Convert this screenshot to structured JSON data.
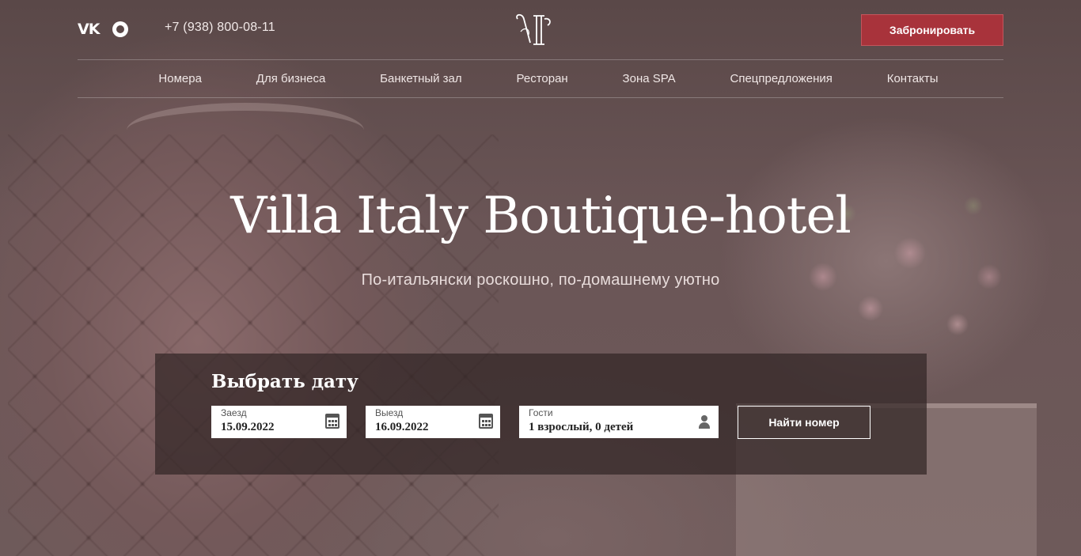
{
  "header": {
    "social": {
      "vk_icon": "vk-icon",
      "whatsapp_icon": "whatsapp-icon",
      "vk_glyph": "VK"
    },
    "phone": "+7 (938) 800-08-11",
    "book_button": "Забронировать",
    "brand_color": "#a8333b"
  },
  "nav": {
    "items": [
      {
        "label": "Номера"
      },
      {
        "label": "Для бизнеса"
      },
      {
        "label": "Банкетный зал"
      },
      {
        "label": "Ресторан"
      },
      {
        "label": "Зона SPA"
      },
      {
        "label": "Спецпредложения"
      },
      {
        "label": "Контакты"
      }
    ]
  },
  "hero": {
    "title": "Villa Italy Boutique-hotel",
    "subtitle": "По-итальянски роскошно, по-домашнему уютно"
  },
  "booking": {
    "title": "Выбрать дату",
    "checkin": {
      "label": "Заезд",
      "value": "15.09.2022",
      "icon": "calendar-icon"
    },
    "checkout": {
      "label": "Выезд",
      "value": "16.09.2022",
      "icon": "calendar-icon"
    },
    "guests": {
      "label": "Гости",
      "value": "1 взрослый, 0 детей",
      "icon": "user-icon"
    },
    "search_button": "Найти номер"
  }
}
